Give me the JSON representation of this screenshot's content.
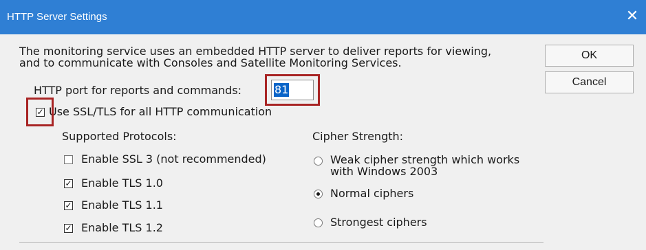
{
  "window": {
    "title": "HTTP Server Settings",
    "close_glyph": "✕"
  },
  "description": "The monitoring service uses an embedded HTTP server to deliver reports for viewing,\nand to communicate with Consoles and Satellite Monitoring Services.",
  "buttons": {
    "ok": "OK",
    "cancel": "Cancel"
  },
  "port": {
    "label": "HTTP port for reports and commands:",
    "value": "81"
  },
  "ssl": {
    "label": "Use SSL/TLS for all HTTP communication",
    "checked": true
  },
  "protocols": {
    "heading": "Supported Protocols:",
    "items": [
      {
        "label": "Enable SSL 3 (not recommended)",
        "checked": false
      },
      {
        "label": "Enable TLS 1.0",
        "checked": true
      },
      {
        "label": "Enable TLS 1.1",
        "checked": true
      },
      {
        "label": "Enable TLS 1.2",
        "checked": true
      }
    ]
  },
  "cipher": {
    "heading": "Cipher Strength:",
    "options": [
      {
        "label": "Weak cipher strength which works\nwith Windows 2003",
        "selected": false
      },
      {
        "label": "Normal ciphers",
        "selected": true
      },
      {
        "label": "Strongest ciphers",
        "selected": false
      }
    ]
  },
  "colors": {
    "titlebar": "#2f7fd4",
    "highlight": "#a82424",
    "selection": "#0a64c8"
  }
}
